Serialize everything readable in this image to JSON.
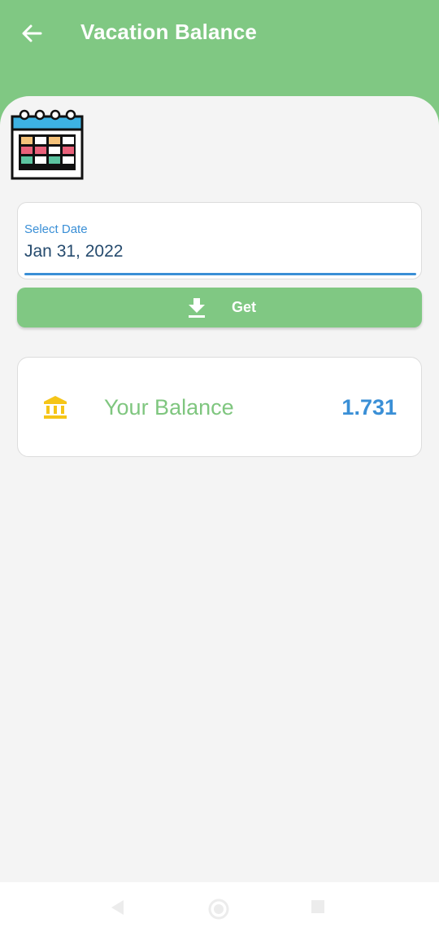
{
  "header": {
    "title": "Vacation Balance"
  },
  "date_field": {
    "label": "Select Date",
    "value": "Jan 31, 2022"
  },
  "get_button": {
    "label": "Get"
  },
  "balance": {
    "label": "Your Balance",
    "value": "1.731"
  },
  "icons": {
    "back": "arrow-left",
    "calendar": "calendar",
    "download": "download",
    "bank": "bank",
    "nav_back": "triangle-left",
    "nav_home": "circle",
    "nav_recents": "square"
  },
  "colors": {
    "primary_green": "#80c883",
    "accent_blue": "#3a8fd6",
    "balance_label_green": "#7fc67f",
    "bank_icon_yellow": "#f5c518",
    "background": "#f4f4f4"
  }
}
